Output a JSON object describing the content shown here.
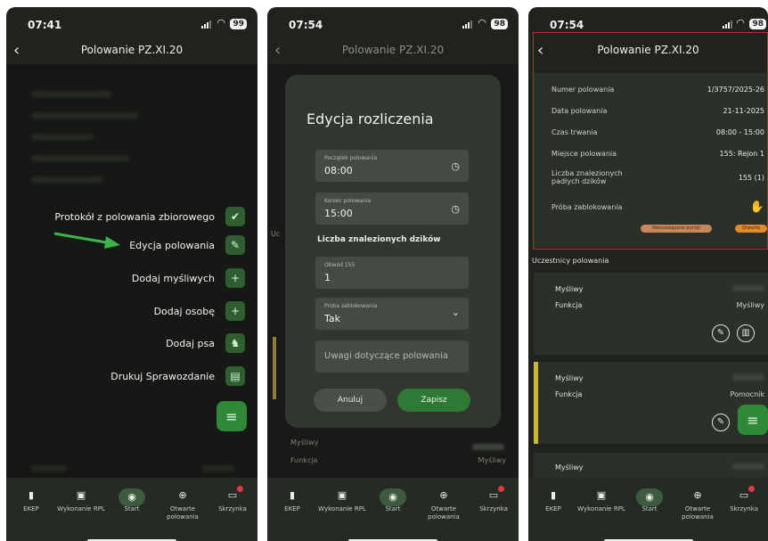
{
  "screens": [
    {
      "time": "07:41",
      "battery": "99",
      "title": "Polowanie PZ.XI.20",
      "menu": [
        {
          "label": "Protokół z polowania zbiorowego",
          "icon": "clipboard-check-icon"
        },
        {
          "label": "Edycja polowania",
          "icon": "pencil-icon"
        },
        {
          "label": "Dodaj myśliwych",
          "icon": "add-people-icon"
        },
        {
          "label": "Dodaj osobę",
          "icon": "add-person-icon"
        },
        {
          "label": "Dodaj psa",
          "icon": "dog-icon"
        },
        {
          "label": "Drukuj Sprawozdanie",
          "icon": "document-icon"
        }
      ],
      "arrow_color": "#3bb54a"
    },
    {
      "time": "07:54",
      "battery": "98",
      "title": "Polowanie PZ.XI.20",
      "side_label": "Uc",
      "dialog": {
        "title": "Edycja rozliczenia",
        "start_label": "Początek polowania",
        "start_value": "08:00",
        "end_label": "Koniec polowania",
        "end_value": "15:00",
        "boars_heading": "Liczba znalezionych dzików",
        "district_label": "Obwód 155",
        "district_value": "1",
        "attempt_label": "Próba zablokowania",
        "attempt_value": "Tak",
        "notes_placeholder": "Uwagi dotyczące polowania",
        "cancel": "Anuluj",
        "save": "Zapisz"
      },
      "behind": {
        "hunter_label": "Myśliwy",
        "function_label": "Funkcja",
        "function_value": "Myśliwy"
      }
    },
    {
      "time": "07:54",
      "battery": "98",
      "title": "Polowanie PZ.XI.20",
      "info": [
        {
          "label": "Numer polowania",
          "value": "1/3757/2025-26"
        },
        {
          "label": "Data polowania",
          "value": "21-11-2025"
        },
        {
          "label": "Czas trwania",
          "value": "08:00 - 15:00"
        },
        {
          "label": "Miejsce polowania",
          "value": "155: Rejon 1"
        },
        {
          "label": "Liczba znalezionych padłych dzików",
          "value": "155 (1)"
        },
        {
          "label": "Próba zablokowania",
          "value": ""
        }
      ],
      "pills": [
        "Nierozwiązane wyniki",
        "Otwarte"
      ],
      "participants_heading": "Uczestnicy polowania",
      "cards": [
        {
          "hunter_label": "Myśliwy",
          "function_label": "Funkcja",
          "function_value": "Myśliwy"
        },
        {
          "hunter_label": "Myśliwy",
          "function_label": "Funkcja",
          "function_value": "Pomocnik"
        },
        {
          "hunter_label": "Myśliwy"
        }
      ]
    }
  ],
  "tabbar": [
    {
      "label": "EKEP",
      "icon": "book-icon"
    },
    {
      "label": "Wykonanie RPL",
      "icon": "calendar-icon"
    },
    {
      "label": "Start",
      "icon": "map-pin-icon"
    },
    {
      "label": "Otwarte polowania",
      "icon": "target-icon"
    },
    {
      "label": "Skrzynka",
      "icon": "inbox-icon"
    }
  ],
  "colors": {
    "background": "#1f221d",
    "accent": "#2e8a38",
    "highlight_border": "#c02a2a",
    "card_stripe": "#c9b73a"
  }
}
